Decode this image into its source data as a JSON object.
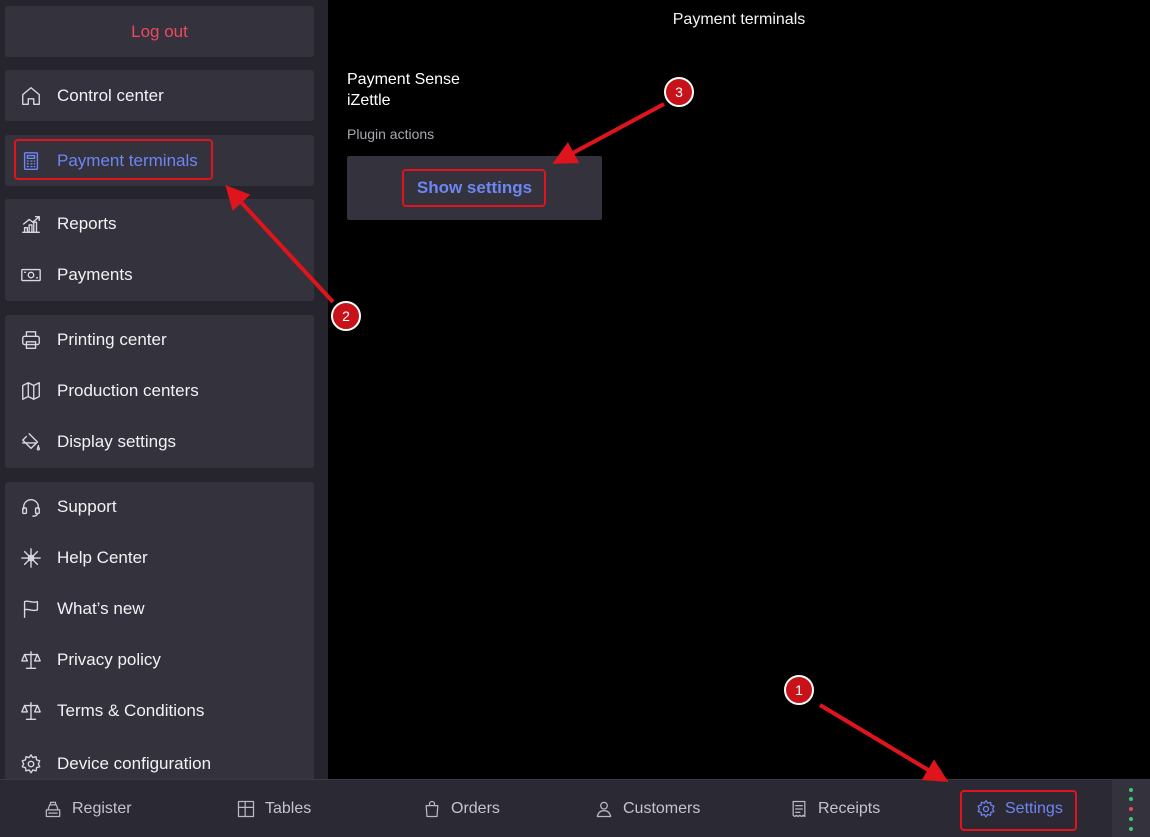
{
  "sidebar": {
    "logout_label": "Log out",
    "groups": [
      [
        {
          "label": "Control center",
          "icon": "home-icon"
        }
      ],
      [
        {
          "label": "Payment terminals",
          "icon": "calculator-icon",
          "active": true
        }
      ],
      [
        {
          "label": "Reports",
          "icon": "chart-icon"
        },
        {
          "label": "Payments",
          "icon": "cash-icon"
        }
      ],
      [
        {
          "label": "Printing center",
          "icon": "printer-icon"
        },
        {
          "label": "Production centers",
          "icon": "map-icon"
        },
        {
          "label": "Display settings",
          "icon": "paint-bucket-icon"
        }
      ],
      [
        {
          "label": "Support",
          "icon": "headset-icon"
        },
        {
          "label": "Help Center",
          "icon": "compass-star-icon"
        },
        {
          "label": "What’s new",
          "icon": "flag-icon"
        },
        {
          "label": "Privacy policy",
          "icon": "scale-icon"
        },
        {
          "label": "Terms & Conditions",
          "icon": "scale-icon"
        },
        {
          "label": "Device configuration",
          "icon": "gear-icon"
        }
      ]
    ]
  },
  "main": {
    "title": "Payment terminals",
    "plugins": [
      "Payment Sense",
      "iZettle"
    ],
    "section_label": "Plugin actions",
    "show_settings_label": "Show settings"
  },
  "tabbar": {
    "tabs": [
      {
        "label": "Register",
        "icon": "register-icon"
      },
      {
        "label": "Tables",
        "icon": "tables-icon"
      },
      {
        "label": "Orders",
        "icon": "bag-icon"
      },
      {
        "label": "Customers",
        "icon": "user-icon"
      },
      {
        "label": "Receipts",
        "icon": "receipt-icon"
      },
      {
        "label": "Settings",
        "icon": "gear-icon",
        "active": true
      }
    ],
    "status_dot_colors": [
      "#3ec77a",
      "#3ec77a",
      "#e8485a",
      "#3ec77a",
      "#3ec77a"
    ]
  },
  "annotations": {
    "highlight_color": "#e0141c",
    "badges": [
      "1",
      "2",
      "3"
    ]
  }
}
